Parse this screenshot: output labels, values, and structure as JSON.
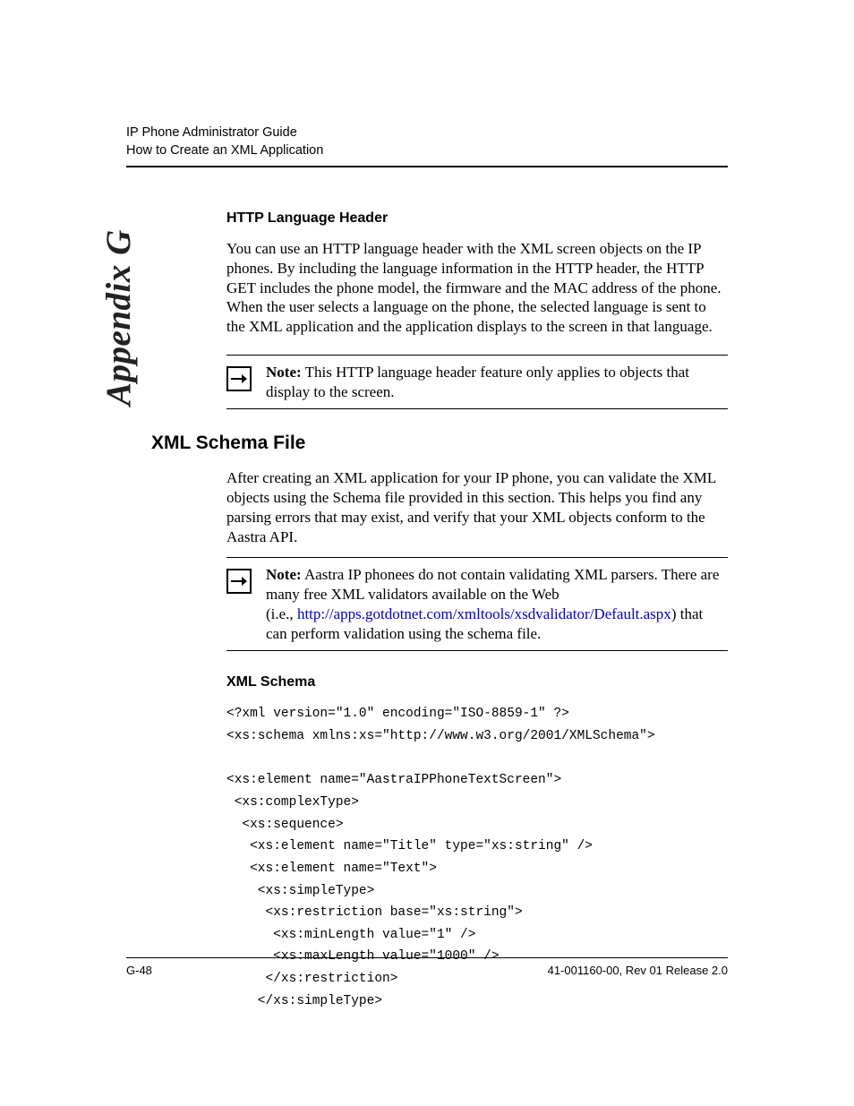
{
  "runningHead": {
    "line1": "IP Phone Administrator Guide",
    "line2": "How to Create an XML Application"
  },
  "sideTab": "Appendix G",
  "section1": {
    "heading": "HTTP Language Header",
    "para": "You can use an HTTP language header with the XML screen objects on the IP phones. By including the language information in the HTTP header, the HTTP GET includes the phone model, the firmware and the MAC address of the phone. When the user selects a language on the phone, the selected language is sent to the XML application and the application displays to the screen in that language."
  },
  "note1": {
    "label": "Note:",
    "text": " This HTTP language header feature only applies to objects that display to the screen."
  },
  "h2": "XML Schema File",
  "section2": {
    "para": "After creating an XML application for your IP phone, you can validate the XML objects using the Schema file provided in this section. This helps you find any parsing errors that may exist, and verify that your XML objects conform to the Aastra API."
  },
  "note2": {
    "label": "Note:",
    "textA": " Aastra IP phonees do not contain validating XML parsers. There are many free XML validators available on the Web",
    "textB_prefix": "(i.e., ",
    "link": "http://apps.gotdotnet.com/xmltools/xsdvalidator/Default.aspx",
    "textB_suffix": ") that can perform validation using the schema file."
  },
  "section3": {
    "heading": "XML Schema"
  },
  "code": "<?xml version=\"1.0\" encoding=\"ISO-8859-1\" ?>\n<xs:schema xmlns:xs=\"http://www.w3.org/2001/XMLSchema\">\n\n<xs:element name=\"AastraIPPhoneTextScreen\">\n <xs:complexType>\n  <xs:sequence>\n   <xs:element name=\"Title\" type=\"xs:string\" />\n   <xs:element name=\"Text\">\n    <xs:simpleType>\n     <xs:restriction base=\"xs:string\">\n      <xs:minLength value=\"1\" />\n      <xs:maxLength value=\"1000\" />\n     </xs:restriction>\n    </xs:simpleType>",
  "footer": {
    "left": "G-48",
    "right": "41-001160-00, Rev 01 Release 2.0"
  }
}
